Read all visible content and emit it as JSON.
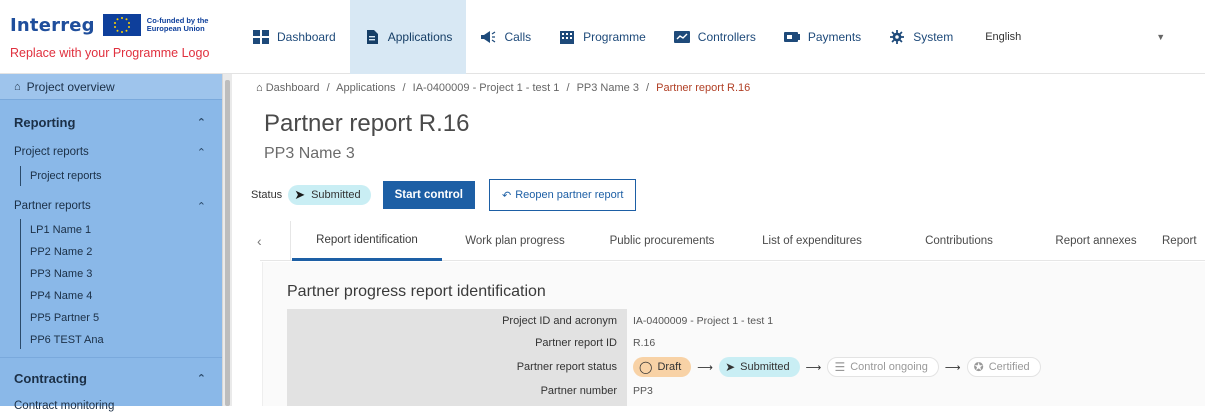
{
  "brand": {
    "logo_text": "Interreg",
    "cofunded_text": "Co-funded by the European Union",
    "placeholder_text": "Replace with your Programme Logo"
  },
  "nav": {
    "items": [
      {
        "label": "Dashboard",
        "icon": "dashboard-grid-icon",
        "active": false
      },
      {
        "label": "Applications",
        "icon": "document-icon",
        "active": true
      },
      {
        "label": "Calls",
        "icon": "megaphone-icon",
        "active": false
      },
      {
        "label": "Programme",
        "icon": "building-icon",
        "active": false
      },
      {
        "label": "Controllers",
        "icon": "controller-icon",
        "active": false
      },
      {
        "label": "Payments",
        "icon": "payments-icon",
        "active": false
      },
      {
        "label": "System",
        "icon": "gear-icon",
        "active": false
      }
    ],
    "language": "English"
  },
  "sidebar": {
    "project_overview": "Project overview",
    "reporting": "Reporting",
    "project_reports": "Project reports",
    "project_reports_leaf": "Project reports",
    "partner_reports": "Partner reports",
    "partners": [
      "LP1 Name 1",
      "PP2 Name 2",
      "PP3 Name 3",
      "PP4 Name 4",
      "PP5 Partner 5",
      "PP6 TEST Ana"
    ],
    "contracting": "Contracting",
    "contract_monitoring": "Contract monitoring"
  },
  "breadcrumb": {
    "items": [
      "Dashboard",
      "Applications",
      "IA-0400009 - Project 1 - test 1",
      "PP3 Name 3"
    ],
    "current": "Partner report R.16",
    "separator": "/"
  },
  "page": {
    "title": "Partner report R.16",
    "subtitle": "PP3 Name 3"
  },
  "status": {
    "label": "Status",
    "value": "Submitted",
    "start_control": "Start control",
    "reopen": "Reopen partner report"
  },
  "tabs": [
    "Report identification",
    "Work plan progress",
    "Public procurements",
    "List of expenditures",
    "Contributions",
    "Report annexes",
    "Report"
  ],
  "section": {
    "title": "Partner progress report identification",
    "rows": [
      {
        "label": "Project ID and acronym",
        "value": "IA-0400009 - Project 1 - test 1"
      },
      {
        "label": "Partner report ID",
        "value": "R.16"
      },
      {
        "label": "Partner report status",
        "value": ""
      },
      {
        "label": "Partner number",
        "value": "PP3"
      }
    ],
    "workflow": [
      "Draft",
      "Submitted",
      "Control ongoing",
      "Certified"
    ]
  },
  "colors": {
    "sidebar_bg": "#8ab8e8",
    "primary": "#1d5fa5",
    "submitted_pill": "#c9eef4",
    "draft_pill": "#f8d2a6",
    "breadcrumb_current": "#b14026",
    "logo_sub": "#e0303e"
  }
}
